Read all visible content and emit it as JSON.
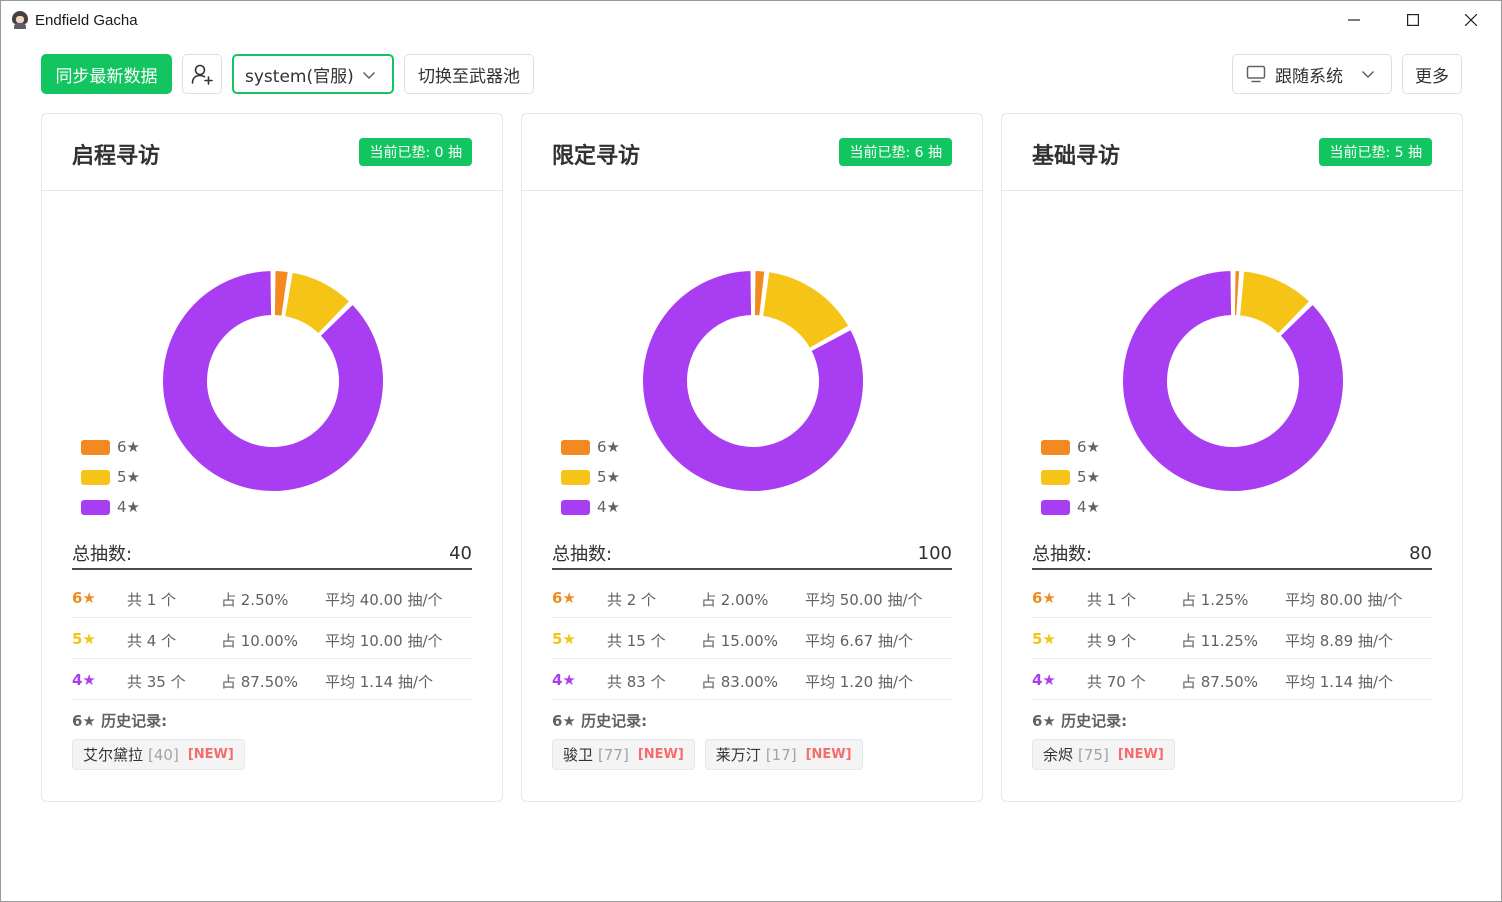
{
  "window": {
    "title": "Endfield Gacha"
  },
  "colors": {
    "accent": "#13c561",
    "six_star": "#f28a1f",
    "five_star": "#f5c416",
    "four_star": "#a93df2",
    "new_tag": "#f56c6c"
  },
  "toolbar": {
    "sync_label": "同步最新数据",
    "account_value": "system(官服)",
    "switch_pool_label": "切换至武器池",
    "theme_value": "跟随系统",
    "more_label": "更多"
  },
  "pools": [
    {
      "title": "启程寻访",
      "pity": "当前已垫: 0 抽",
      "legend": [
        "6★",
        "5★",
        "4★"
      ],
      "total_label": "总抽数:",
      "total_value": "40",
      "chart_data": {
        "type": "pie",
        "categories": [
          "6★",
          "5★",
          "4★"
        ],
        "values": [
          1,
          4,
          35
        ],
        "colors": [
          "#f28a1f",
          "#f5c416",
          "#a93df2"
        ],
        "donut": true
      },
      "rows": [
        {
          "star": "6★",
          "count": "共 1 个",
          "pct": "占 2.50%",
          "avg": "平均 40.00 抽/个"
        },
        {
          "star": "5★",
          "count": "共 4 个",
          "pct": "占 10.00%",
          "avg": "平均 10.00 抽/个"
        },
        {
          "star": "4★",
          "count": "共 35 个",
          "pct": "占 87.50%",
          "avg": "平均 1.14 抽/个"
        }
      ],
      "history_title": "6★ 历史记录:",
      "history": [
        {
          "name": "艾尔黛拉",
          "pulls": "[40]",
          "tag": "[NEW]"
        }
      ]
    },
    {
      "title": "限定寻访",
      "pity": "当前已垫: 6 抽",
      "legend": [
        "6★",
        "5★",
        "4★"
      ],
      "total_label": "总抽数:",
      "total_value": "100",
      "chart_data": {
        "type": "pie",
        "categories": [
          "6★",
          "5★",
          "4★"
        ],
        "values": [
          2,
          15,
          83
        ],
        "colors": [
          "#f28a1f",
          "#f5c416",
          "#a93df2"
        ],
        "donut": true
      },
      "rows": [
        {
          "star": "6★",
          "count": "共 2 个",
          "pct": "占 2.00%",
          "avg": "平均 50.00 抽/个"
        },
        {
          "star": "5★",
          "count": "共 15 个",
          "pct": "占 15.00%",
          "avg": "平均 6.67 抽/个"
        },
        {
          "star": "4★",
          "count": "共 83 个",
          "pct": "占 83.00%",
          "avg": "平均 1.20 抽/个"
        }
      ],
      "history_title": "6★ 历史记录:",
      "history": [
        {
          "name": "骏卫",
          "pulls": "[77]",
          "tag": "[NEW]"
        },
        {
          "name": "莱万汀",
          "pulls": "[17]",
          "tag": "[NEW]"
        }
      ]
    },
    {
      "title": "基础寻访",
      "pity": "当前已垫: 5 抽",
      "legend": [
        "6★",
        "5★",
        "4★"
      ],
      "total_label": "总抽数:",
      "total_value": "80",
      "chart_data": {
        "type": "pie",
        "categories": [
          "6★",
          "5★",
          "4★"
        ],
        "values": [
          1,
          9,
          70
        ],
        "colors": [
          "#f28a1f",
          "#f5c416",
          "#a93df2"
        ],
        "donut": true
      },
      "rows": [
        {
          "star": "6★",
          "count": "共 1 个",
          "pct": "占 1.25%",
          "avg": "平均 80.00 抽/个"
        },
        {
          "star": "5★",
          "count": "共 9 个",
          "pct": "占 11.25%",
          "avg": "平均 8.89 抽/个"
        },
        {
          "star": "4★",
          "count": "共 70 个",
          "pct": "占 87.50%",
          "avg": "平均 1.14 抽/个"
        }
      ],
      "history_title": "6★ 历史记录:",
      "history": [
        {
          "name": "余烬",
          "pulls": "[75]",
          "tag": "[NEW]"
        }
      ]
    }
  ]
}
